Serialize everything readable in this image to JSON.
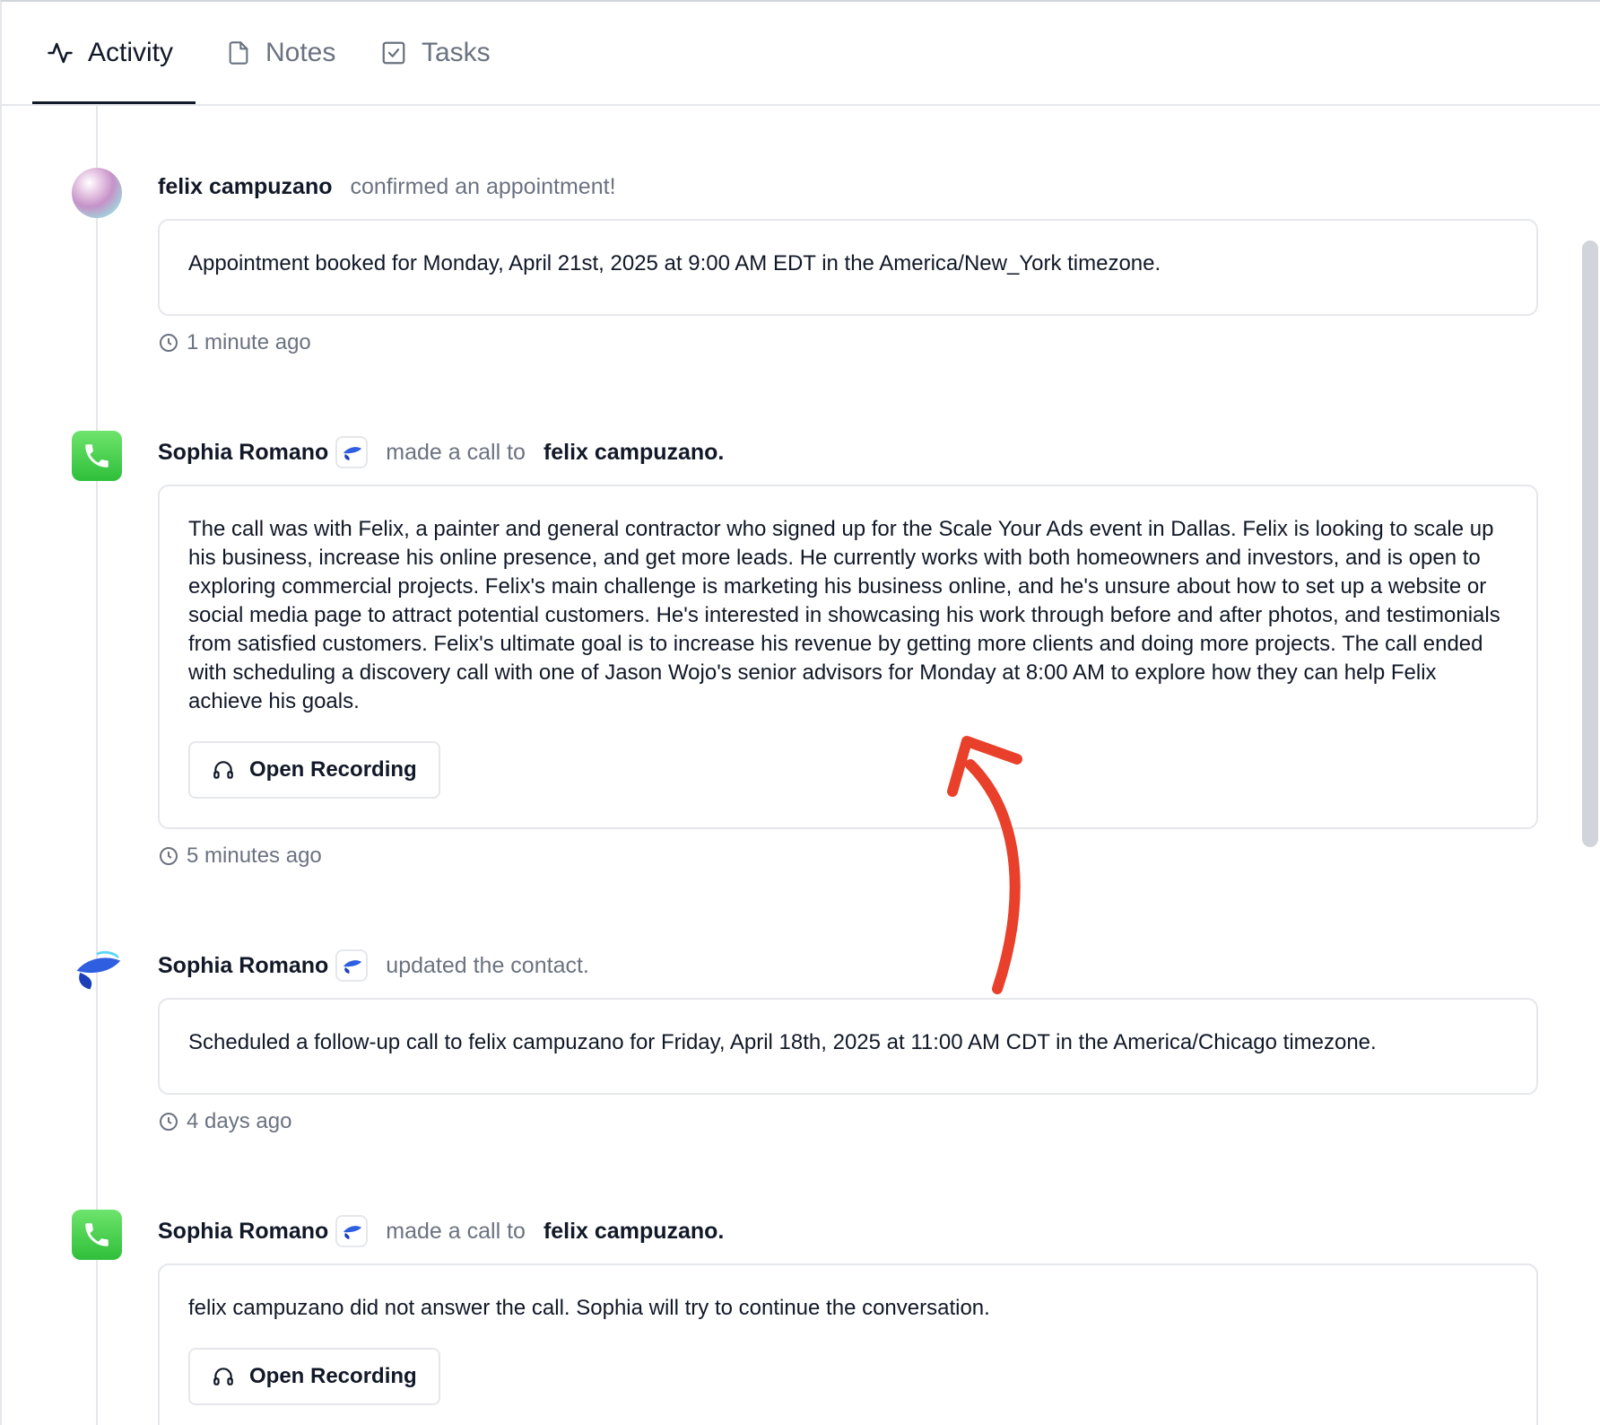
{
  "tabs": [
    {
      "label": "Activity",
      "icon": "activity-icon",
      "active": true
    },
    {
      "label": "Notes",
      "icon": "document-icon",
      "active": false
    },
    {
      "label": "Tasks",
      "icon": "checkbox-icon",
      "active": false
    }
  ],
  "entries": [
    {
      "actor": "felix campuzano",
      "verb": "confirmed an appointment!",
      "body": "Appointment booked for Monday, April 21st, 2025 at 9:00 AM EDT in the America/New_York timezone.",
      "time": "1 minute ago",
      "avatar": "gradient-avatar"
    },
    {
      "actor": "Sophia Romano",
      "verb": "made a call to",
      "target": "felix campuzano.",
      "body": "The call was with Felix, a painter and general contractor who signed up for the Scale Your Ads event in Dallas. Felix is looking to scale up his business, increase his online presence, and get more leads. He currently works with both homeowners and investors, and is open to exploring commercial projects. Felix's main challenge is marketing his business online, and he's unsure about how to set up a website or social media page to attract potential customers. He's interested in showcasing his work through before and after photos, and testimonials from satisfied customers. Felix's ultimate goal is to increase his revenue by getting more clients and doing more projects. The call ended with scheduling a discovery call with one of Jason Wojo's senior advisors for Monday at 8:00 AM to explore how they can help Felix achieve his goals.",
      "button": "Open Recording",
      "time": "5 minutes ago",
      "avatar": "phone-icon"
    },
    {
      "actor": "Sophia Romano",
      "verb": "updated the contact.",
      "body": "Scheduled a follow-up call to felix campuzano for Friday, April 18th, 2025 at 11:00 AM CDT in the America/Chicago timezone.",
      "time": "4 days ago",
      "avatar": "agent-logo-icon"
    },
    {
      "actor": "Sophia Romano",
      "verb": "made a call to",
      "target": "felix campuzano.",
      "body": "felix campuzano did not answer the call. Sophia will try to continue the conversation.",
      "button": "Open Recording",
      "avatar": "phone-icon"
    }
  ],
  "colors": {
    "annotation_arrow": "#e8402a",
    "phone_green": "#3ccf45",
    "agent_blue": "#2f5fe0"
  }
}
